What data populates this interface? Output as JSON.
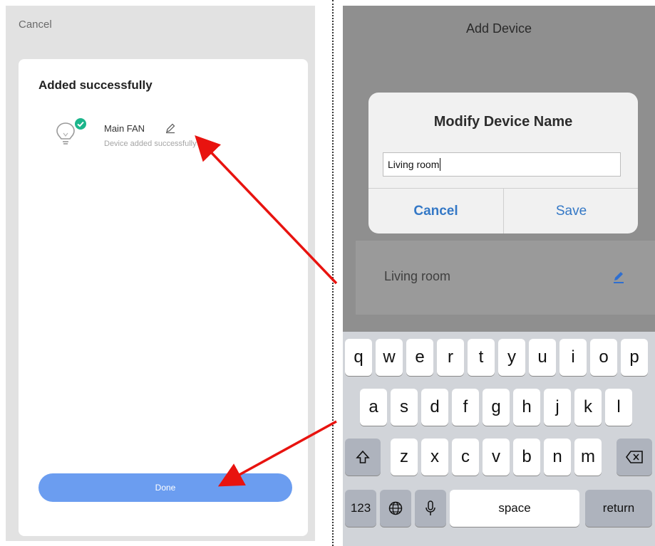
{
  "left_screen": {
    "cancel_label": "Cancel",
    "card_title": "Added successfully",
    "device": {
      "name": "Main FAN",
      "status": "Device added successfully",
      "icon": "bulb-icon",
      "badge_icon": "check-badge-icon",
      "edit_icon": "pencil-icon"
    },
    "done_label": "Done"
  },
  "right_screen": {
    "nav_title": "Add Device",
    "dialog": {
      "title": "Modify Device Name",
      "input_value": "Living room",
      "cancel_label": "Cancel",
      "save_label": "Save"
    },
    "device_row_label": "Living room",
    "keyboard": {
      "row1": [
        "q",
        "w",
        "e",
        "r",
        "t",
        "y",
        "u",
        "i",
        "o",
        "p"
      ],
      "row2": [
        "a",
        "s",
        "d",
        "f",
        "g",
        "h",
        "j",
        "k",
        "l"
      ],
      "row3": [
        "z",
        "x",
        "c",
        "v",
        "b",
        "n",
        "m"
      ],
      "numbers_label": "123",
      "space_label": "space",
      "return_label": "return"
    }
  },
  "colors": {
    "primary_button": "#6b9df0",
    "check_badge": "#1bb58b",
    "dialog_action": "#3478c6",
    "annotation_arrow": "#e8130f"
  }
}
